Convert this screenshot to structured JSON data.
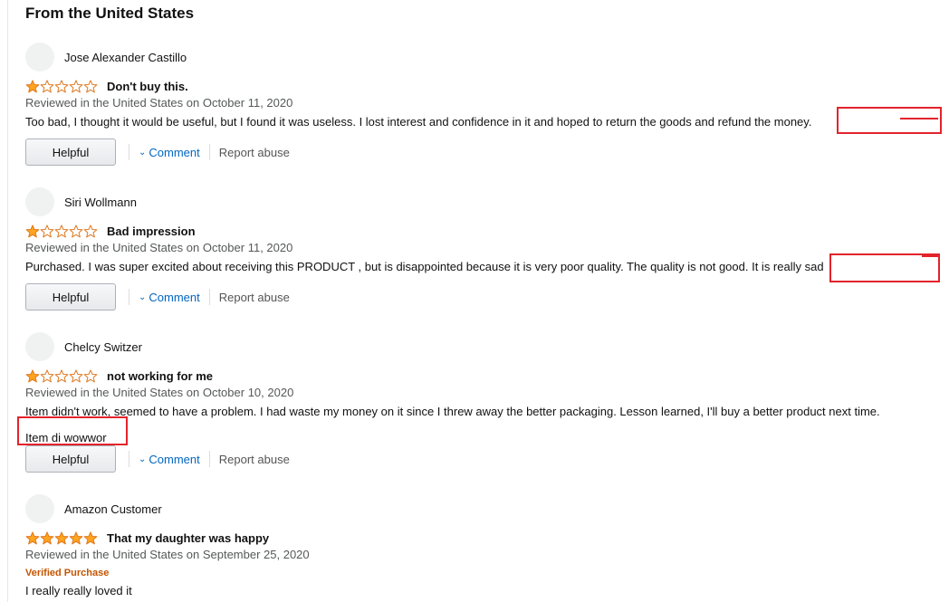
{
  "section": {
    "title": "From the United States"
  },
  "colors": {
    "star_fill": "#ffa41c",
    "star_stroke": "#de7921",
    "redaction": "#e3232c",
    "link": "#0066c0"
  },
  "reviews": [
    {
      "profile_name": "Jose Alexander Castillo",
      "rating": 1,
      "title": "Don't buy this.",
      "date": "Reviewed in the United States on October 11, 2020",
      "body": "Too bad, I thought it would be useful, but I found it was useless. I lost interest and confidence in it and hoped to return the goods and refund the money.",
      "helpful_label": "Helpful",
      "comment_label": "Comment",
      "report_label": "Report abuse"
    },
    {
      "profile_name": "Siri Wollmann",
      "rating": 1,
      "title": "Bad impression",
      "date": "Reviewed in the United States on October 11, 2020",
      "body": "Purchased. I was super excited about receiving this PRODUCT , but is disappointed because it is very poor quality. The quality is not good. It is really sad",
      "helpful_label": "Helpful",
      "comment_label": "Comment",
      "report_label": "Report abuse"
    },
    {
      "profile_name": "Chelcy Switzer",
      "rating": 1,
      "title": "not working for me",
      "date": "Reviewed in the United States on October 10, 2020",
      "body": "Item didn't work, seemed to have a problem. I had waste my money on it since I threw away the better packaging. Lesson learned, I'll buy a better product next time.",
      "body_extra": "Item di wowwor",
      "helpful_label": "Helpful",
      "comment_label": "Comment",
      "report_label": "Report abuse"
    },
    {
      "profile_name": "Amazon Customer",
      "rating": 5,
      "title": "That my daughter was happy",
      "date": "Reviewed in the United States on September 25, 2020",
      "verified": "Verified Purchase",
      "body": "I really really loved it"
    }
  ]
}
